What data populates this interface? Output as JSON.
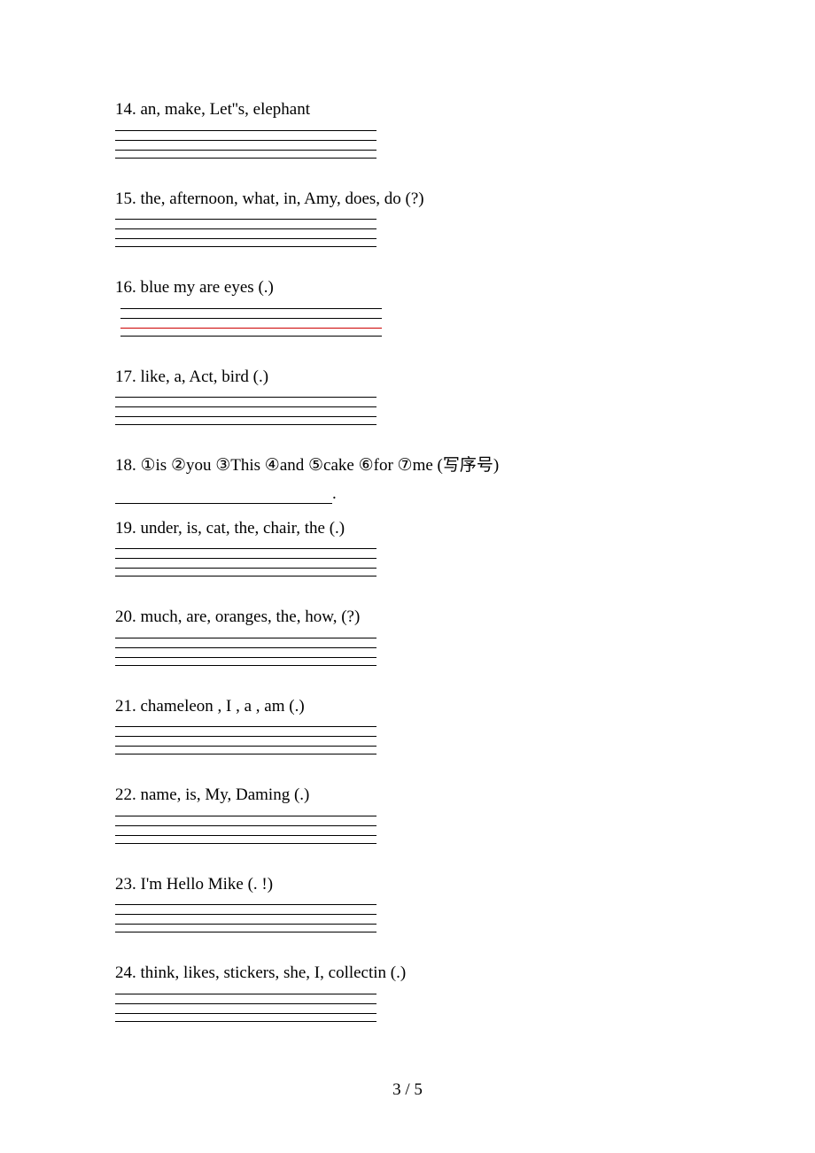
{
  "questions": {
    "q14": "14. an, make, Let''s, elephant",
    "q15": "15. the, afternoon, what, in, Amy, does, do (?)",
    "q16": "16. blue  my  are  eyes (.)",
    "q17": "17. like, a, Act, bird (.)",
    "q18": "18. ①is  ②you  ③This  ④and ⑤cake  ⑥for  ⑦me  (写序号)",
    "q19": "19. under, is, cat, the, chair, the (.)",
    "q20": "20. much, are, oranges, the, how, (?)",
    "q21": "21. chameleon , I , a , am (.)",
    "q22": "22. name, is, My, Daming (.)",
    "q23": "23. I'm Hello   Mike   (. !)",
    "q24": "24. think, likes, stickers, she, I, collectin (.)"
  },
  "q18_period": ".",
  "page_number": "3 / 5"
}
